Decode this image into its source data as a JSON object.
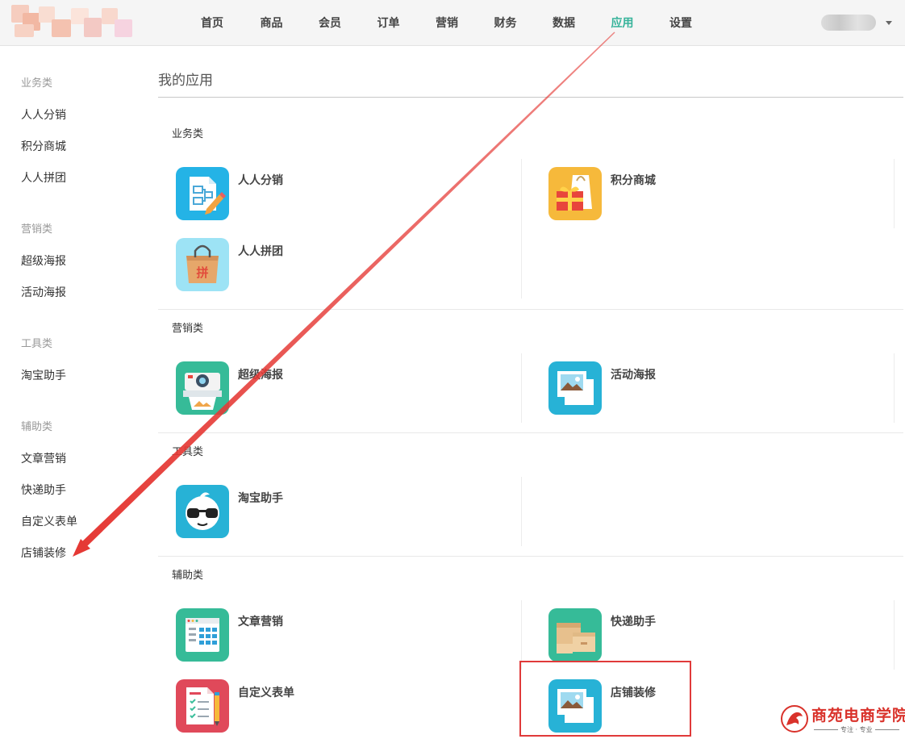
{
  "header": {
    "nav": [
      {
        "label": "首页",
        "active": false
      },
      {
        "label": "商品",
        "active": false
      },
      {
        "label": "会员",
        "active": false
      },
      {
        "label": "订单",
        "active": false
      },
      {
        "label": "营销",
        "active": false
      },
      {
        "label": "财务",
        "active": false
      },
      {
        "label": "数据",
        "active": false
      },
      {
        "label": "应用",
        "active": true
      },
      {
        "label": "设置",
        "active": false
      }
    ],
    "active_color": "#36b39a"
  },
  "sidebar": {
    "groups": [
      {
        "title": "业务类",
        "items": [
          "人人分销",
          "积分商城",
          "人人拼团"
        ]
      },
      {
        "title": "营销类",
        "items": [
          "超级海报",
          "活动海报"
        ]
      },
      {
        "title": "工具类",
        "items": [
          "淘宝助手"
        ]
      },
      {
        "title": "辅助类",
        "items": [
          "文章营销",
          "快递助手",
          "自定义表单",
          "店铺装修"
        ]
      }
    ]
  },
  "main": {
    "title": "我的应用",
    "sections": [
      {
        "title": "业务类",
        "apps": [
          {
            "name": "人人分销",
            "icon": "distribution-icon",
            "color": "#29b6e8"
          },
          {
            "name": "积分商城",
            "icon": "gift-bag-icon",
            "color": "#f6b93b"
          },
          {
            "name": "人人拼团",
            "icon": "shopping-bag-icon",
            "color": "#9de3f5"
          }
        ]
      },
      {
        "title": "营销类",
        "apps": [
          {
            "name": "超级海报",
            "icon": "camera-poster-icon",
            "color": "#3cbf9c"
          },
          {
            "name": "活动海报",
            "icon": "photo-icon",
            "color": "#29b6d8"
          }
        ]
      },
      {
        "title": "工具类",
        "apps": [
          {
            "name": "淘宝助手",
            "icon": "taobao-glasses-icon",
            "color": "#29b6d8"
          }
        ]
      },
      {
        "title": "辅助类",
        "apps": [
          {
            "name": "文章营销",
            "icon": "article-grid-icon",
            "color": "#3cbf9c"
          },
          {
            "name": "快递助手",
            "icon": "package-box-icon",
            "color": "#3cbf9c"
          },
          {
            "name": "自定义表单",
            "icon": "checklist-form-icon",
            "color": "#e0495a"
          },
          {
            "name": "店铺装修",
            "icon": "photo-icon",
            "color": "#29b6d8"
          }
        ]
      }
    ]
  },
  "watermark": {
    "text": "商苑电商学院",
    "sub": "专注 · 专业"
  }
}
